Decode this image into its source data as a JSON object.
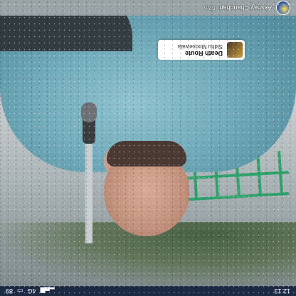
{
  "status_bar": {
    "time": "12:13",
    "carrier": "4G",
    "battery": "89",
    "signal_icon": "signal-icon",
    "battery_icon": "battery-icon"
  },
  "story": {
    "username": "Akshay Chaudhari",
    "time_ago": "52m",
    "avatar_icon": "avatar-icon"
  },
  "music_sticker": {
    "title": "Death Route",
    "artist": "Sidhu Moosewala",
    "art_icon": "album-art-icon"
  },
  "colors": {
    "shirt": "#6fa9b8",
    "railing": "#2fa36b",
    "status_bar": "#1c2a44"
  }
}
